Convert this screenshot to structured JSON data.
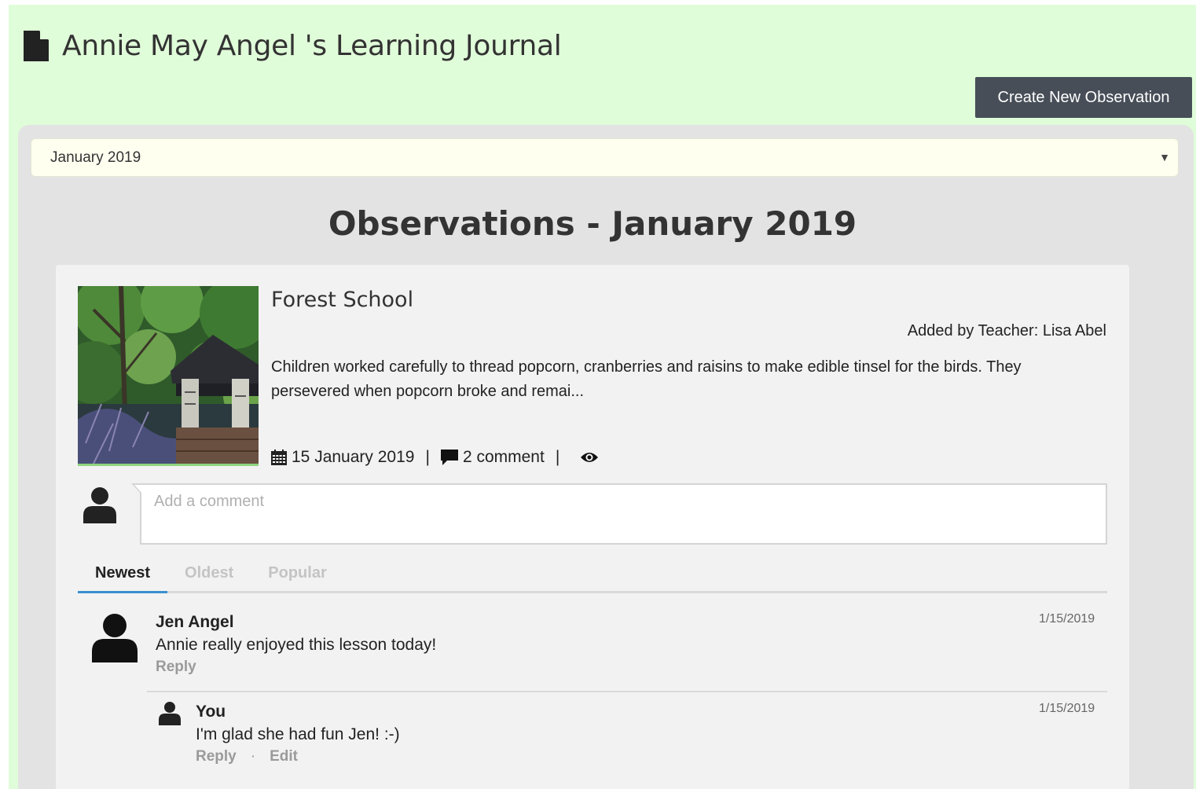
{
  "header": {
    "title": "Annie May Angel 's Learning Journal",
    "icon": "document-icon",
    "create_button": "Create New Observation"
  },
  "filter": {
    "selected_month": "January 2019"
  },
  "observations_heading": "Observations - January 2019",
  "observation": {
    "title": "Forest School",
    "added_by": "Added by Teacher: Lisa Abel",
    "description": "Children worked carefully to thread popcorn, cranberries and raisins to make edible tinsel for the birds. They persevered when popcorn broke and remai...",
    "date": "15 January 2019",
    "comment_count": "2 comment",
    "separator": "|"
  },
  "comment_form": {
    "placeholder": "Add a comment"
  },
  "sort_tabs": [
    "Newest",
    "Oldest",
    "Popular"
  ],
  "comments": [
    {
      "author": "Jen Angel",
      "text": "Annie really enjoyed this lesson today!",
      "date": "1/15/2019",
      "reply_label": "Reply"
    },
    {
      "author": "You",
      "text": "I'm glad she had fun Jen! :-)",
      "date": "1/15/2019",
      "reply_label": "Reply",
      "action_separator": "·",
      "edit_label": "Edit"
    }
  ],
  "colors": {
    "page_background": "#e0fdd9",
    "button_background": "#474e58",
    "active_tab_underline": "#3a8fd0",
    "thumbnail_underline": "#8fd47f"
  }
}
